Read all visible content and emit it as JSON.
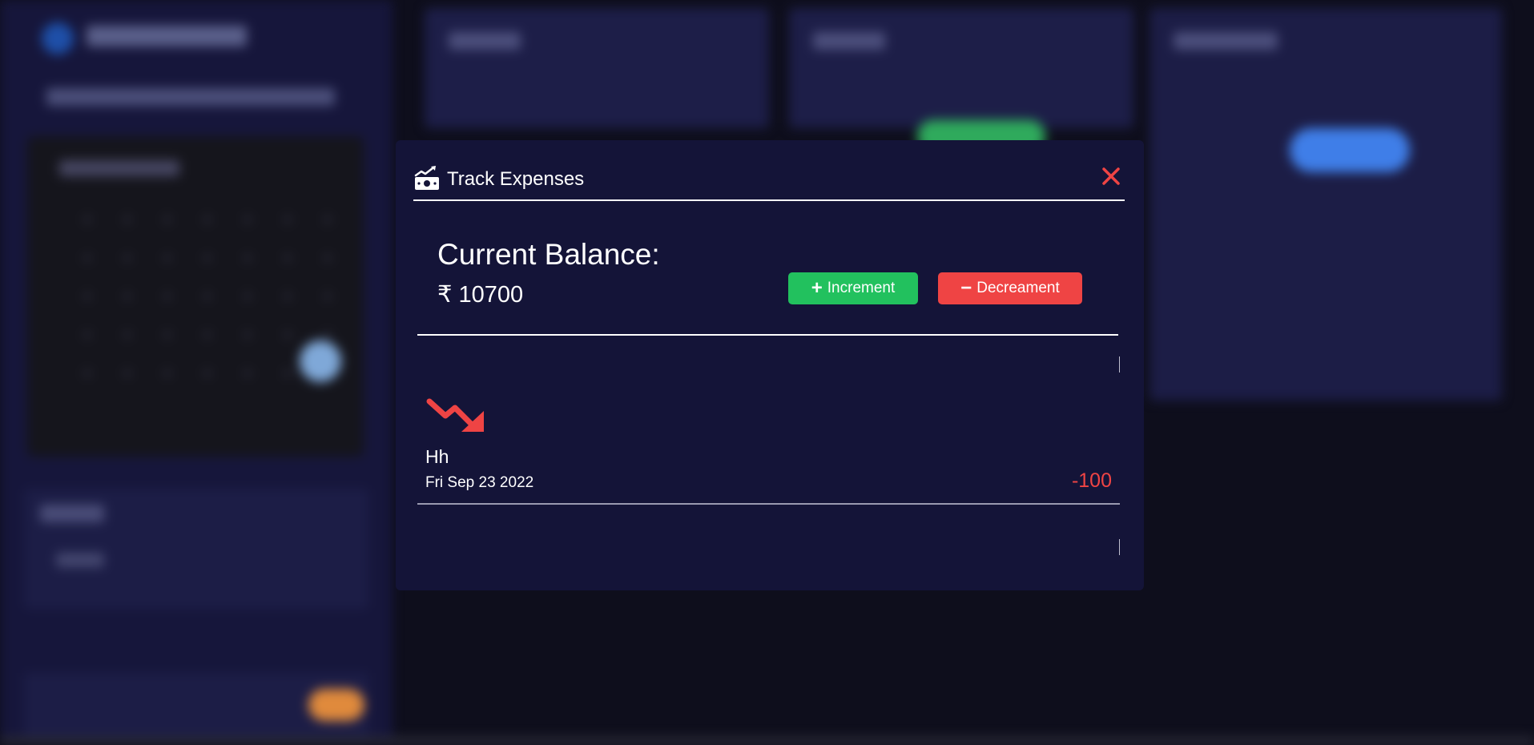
{
  "modal": {
    "icon": "money-chart-icon",
    "title": "Track Expenses",
    "close_icon": "close-icon",
    "close_color": "#ef4444"
  },
  "balance": {
    "label": "Current Balance:",
    "value": "₹ 10700"
  },
  "actions": {
    "increment": {
      "sign": "+",
      "label": "Increment",
      "color": "#22c15e"
    },
    "decrement": {
      "sign": "−",
      "label": "Decreament",
      "color": "#ef4444"
    }
  },
  "transactions": [
    {
      "icon": "trend-down-arrow-icon",
      "name": "Hh",
      "date": "Fri Sep 23 2022",
      "amount": "-100",
      "amount_color": "#ef4444"
    }
  ]
}
